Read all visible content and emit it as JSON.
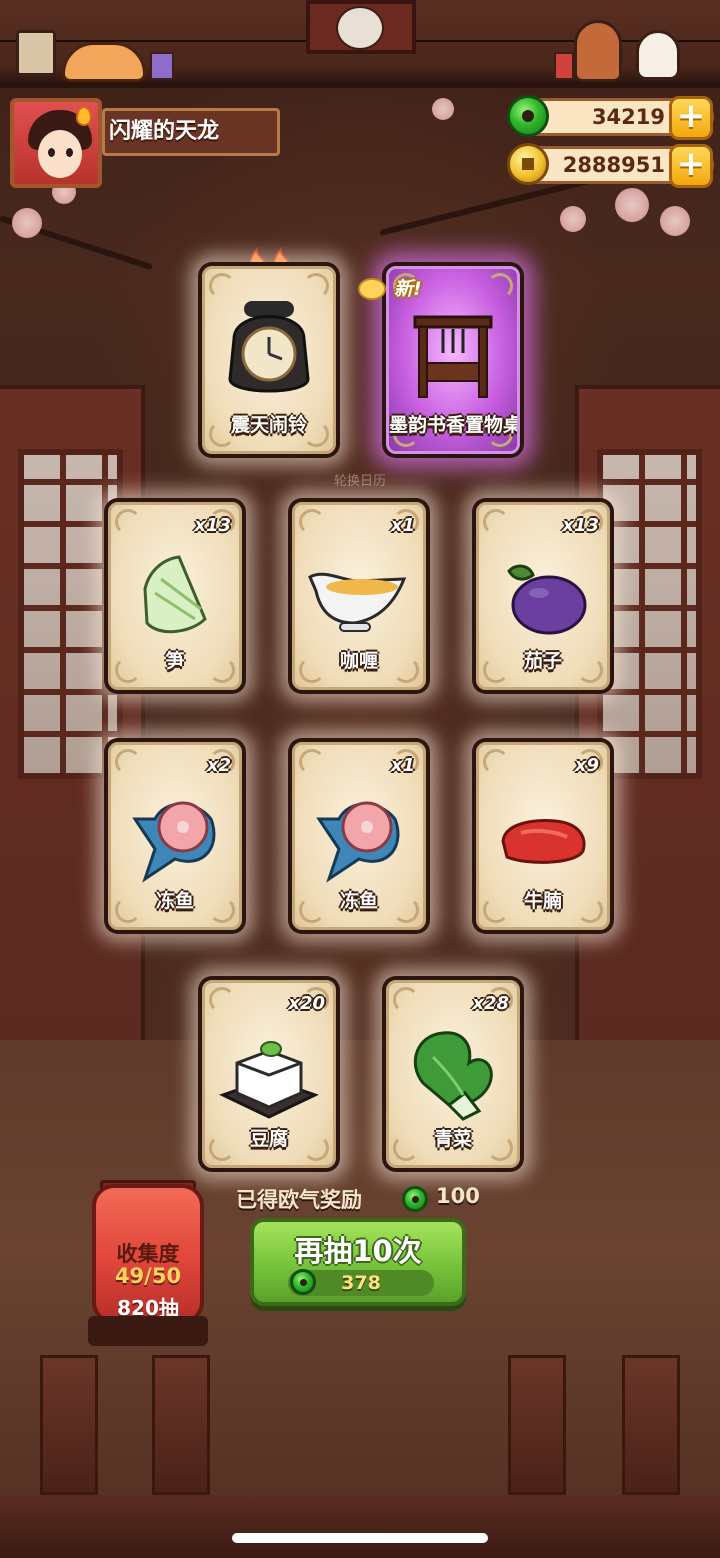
{
  "player": {
    "name": "闪耀的天龙"
  },
  "currencies": [
    {
      "name": "jade",
      "value": "34219"
    },
    {
      "name": "coin",
      "value": "2888951"
    }
  ],
  "top_cards": [
    {
      "label": "震天闹铃",
      "count": "",
      "badge": "hot"
    },
    {
      "label": "墨韵书香置物桌",
      "count": "",
      "badge": "新!"
    }
  ],
  "calendar_hint": "轮换日历",
  "cards": [
    {
      "label": "笋",
      "count": "x13"
    },
    {
      "label": "咖喱",
      "count": "x1"
    },
    {
      "label": "茄子",
      "count": "x13"
    },
    {
      "label": "冻鱼",
      "count": "x2"
    },
    {
      "label": "冻鱼",
      "count": "x1"
    },
    {
      "label": "牛腩",
      "count": "x9"
    },
    {
      "label": "豆腐",
      "count": "x20"
    },
    {
      "label": "青菜",
      "count": "x28"
    }
  ],
  "luck": {
    "label": "已得欧气奖励",
    "amount": "100"
  },
  "draw_button": {
    "label": "再抽10次",
    "cost": "378"
  },
  "collection": {
    "title": "收集度",
    "progress": "49/50",
    "draws": "820抽"
  },
  "colors": {
    "jade": "#2fb82a",
    "coin": "#f1c02b",
    "button": "#76c23a",
    "new_card_glow": "#c85fe0"
  }
}
